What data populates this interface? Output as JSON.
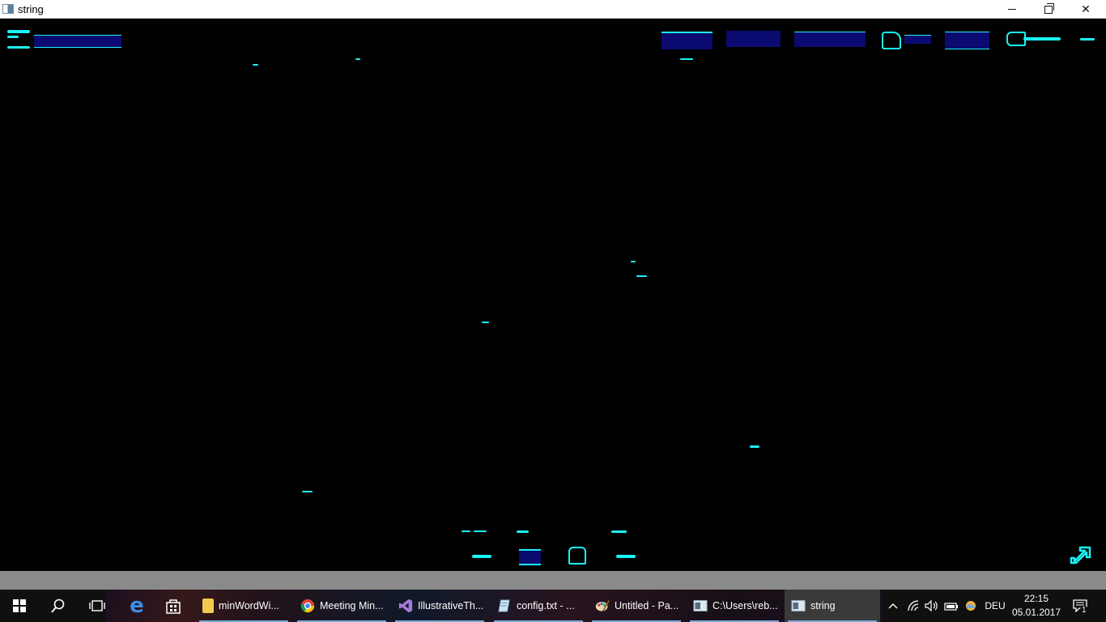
{
  "window": {
    "title": "string",
    "minimize_label": "–",
    "close_label": "✕"
  },
  "taskbar": {
    "apps": [
      {
        "label": "minWordWi...",
        "icon": "folder-icon",
        "color": "#f2c94c"
      },
      {
        "label": "Meeting Min...",
        "icon": "chrome-icon",
        "color": "#db4437"
      },
      {
        "label": "IllustrativeTh...",
        "icon": "visual-studio-icon",
        "color": "#68217a"
      },
      {
        "label": "config.txt - ...",
        "icon": "notepad-icon",
        "color": "#7fb3d5"
      },
      {
        "label": "Untitled - Pa...",
        "icon": "paint-icon",
        "color": "#d4a85a"
      },
      {
        "label": "C:\\Users\\reb...",
        "icon": "console-window-icon",
        "color": "#c8d3dc"
      },
      {
        "label": "string",
        "icon": "app-window-icon",
        "color": "#c8d3dc"
      }
    ],
    "language": "DEU",
    "time": "22:15",
    "date": "05.01.2017",
    "notification_count": "1"
  },
  "colors": {
    "hud_cyan": "#19f3f6",
    "hud_navy": "#0a0a70",
    "background": "#000000"
  }
}
